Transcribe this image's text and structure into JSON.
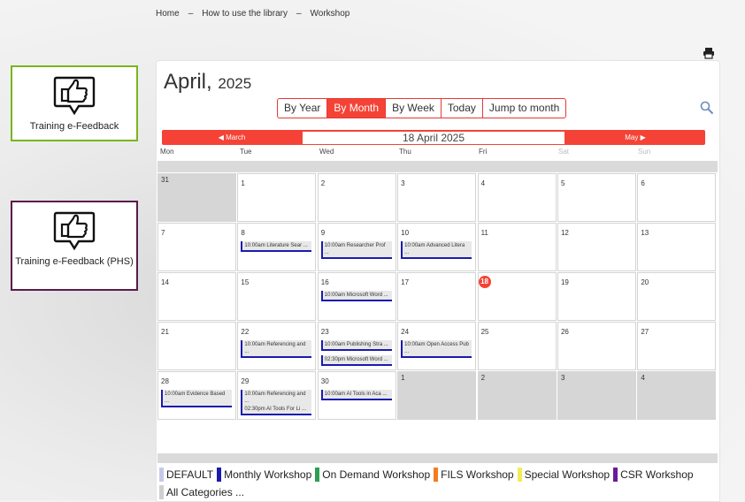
{
  "breadcrumb": {
    "home": "Home",
    "sep": "–",
    "level2": "How to use the library",
    "level3": "Workshop"
  },
  "feedback": [
    {
      "label": "Training e-Feedback"
    },
    {
      "label": "Training e-Feedback (PHS)"
    }
  ],
  "calendar": {
    "month": "April,",
    "year": "2025",
    "views": [
      "By Year",
      "By Month",
      "By Week",
      "Today",
      "Jump to month"
    ],
    "active_view": "By Month",
    "nav": {
      "prev": "March",
      "current": "18 April 2025",
      "next": "May"
    },
    "days_of_week": [
      "Mon",
      "Tue",
      "Wed",
      "Thu",
      "Fri",
      "Sat",
      "Sun"
    ],
    "today": "18",
    "weeks": [
      [
        {
          "day": "31",
          "other": true,
          "events": []
        },
        {
          "day": "1",
          "events": []
        },
        {
          "day": "2",
          "events": []
        },
        {
          "day": "3",
          "events": []
        },
        {
          "day": "4",
          "events": []
        },
        {
          "day": "5",
          "events": []
        },
        {
          "day": "6",
          "events": []
        }
      ],
      [
        {
          "day": "7",
          "events": []
        },
        {
          "day": "8",
          "events": [
            "10:00am Literature Sear ..."
          ]
        },
        {
          "day": "9",
          "events": [
            "10:00am Researcher Prof ..."
          ]
        },
        {
          "day": "10",
          "events": [
            "10:00am Advanced Litera ..."
          ]
        },
        {
          "day": "11",
          "events": []
        },
        {
          "day": "12",
          "events": []
        },
        {
          "day": "13",
          "events": []
        }
      ],
      [
        {
          "day": "14",
          "events": []
        },
        {
          "day": "15",
          "events": []
        },
        {
          "day": "16",
          "events": [
            "10:00am Microsoft Word ..."
          ]
        },
        {
          "day": "17",
          "events": []
        },
        {
          "day": "18",
          "today": true,
          "events": []
        },
        {
          "day": "19",
          "events": []
        },
        {
          "day": "20",
          "events": []
        }
      ],
      [
        {
          "day": "21",
          "events": []
        },
        {
          "day": "22",
          "events": [
            "10:00am Referencing and ..."
          ]
        },
        {
          "day": "23",
          "events": [
            "10:00am Publishing Stra ...",
            "02:30pm Microsoft Word ..."
          ]
        },
        {
          "day": "24",
          "events": [
            "10:00am Open Access Pub ..."
          ]
        },
        {
          "day": "25",
          "events": []
        },
        {
          "day": "26",
          "events": []
        },
        {
          "day": "27",
          "events": []
        }
      ],
      [
        {
          "day": "28",
          "events": [
            "10:00am Evidence Based ..."
          ]
        },
        {
          "day": "29",
          "events": [
            "10:00am Referencing and ...",
            "02:30pm AI Tools For Li ..."
          ]
        },
        {
          "day": "30",
          "events": [
            "10:00am AI Tools in Aca ..."
          ]
        },
        {
          "day": "1",
          "other": true,
          "events": []
        },
        {
          "day": "2",
          "other": true,
          "events": []
        },
        {
          "day": "3",
          "other": true,
          "events": []
        },
        {
          "day": "4",
          "other": true,
          "events": []
        }
      ]
    ]
  },
  "legend": {
    "items": [
      {
        "label": "DEFAULT",
        "color": "#c5cae9"
      },
      {
        "label": "Monthly Workshop",
        "color": "#1a1ab0"
      },
      {
        "label": "On Demand Workshop",
        "color": "#2e9e4f"
      },
      {
        "label": "FILS Workshop",
        "color": "#f47c20"
      },
      {
        "label": "Special Workshop",
        "color": "#f0ec5a"
      },
      {
        "label": "CSR Workshop",
        "color": "#6a1b9a"
      }
    ],
    "all_label": "All Categories ...",
    "all_color": "#cfcfcf"
  }
}
